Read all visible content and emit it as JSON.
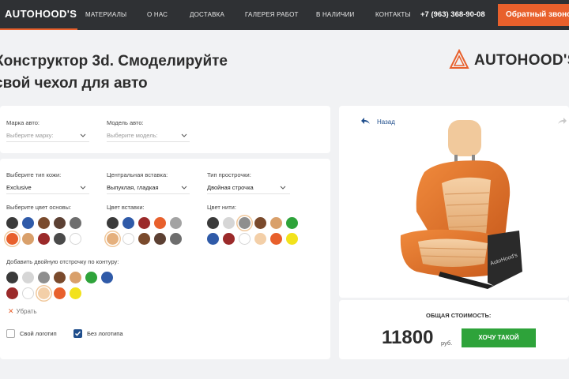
{
  "nav": {
    "logo": "AUTOHOOD'S",
    "links": [
      "МАТЕРИАЛЫ",
      "О НАС",
      "ДОСТАВКА",
      "ГАЛЕРЕЯ РАБОТ",
      "В НАЛИЧИИ",
      "КОНТАКТЫ"
    ],
    "phone": "+7 (963) 368-90-08",
    "callback": "Обратный звонок"
  },
  "header": {
    "title_line1": "Конструктор 3d. Смоделируйте",
    "title_line2": "свой чехол для авто",
    "brand": "AUTOHOOD'S"
  },
  "car": {
    "brand_label": "Марка авто:",
    "brand_placeholder": "Выберите марку:",
    "model_label": "Модель авто:",
    "model_placeholder": "Выберите модель:"
  },
  "options": {
    "leather_label": "Выберите тип кожи:",
    "leather_value": "Exclusive",
    "insert_label": "Центральная вставка:",
    "insert_value": "Выпуклая, гладкая",
    "stitch_label": "Тип прострочки:",
    "stitch_value": "Двойная строчка",
    "base_color_label": "Выберите цвет основы:",
    "insert_color_label": "Цвет вставки:",
    "thread_color_label": "Цвет нити:",
    "double_stitch_label": "Добавить двойную отстрочку по контуру:",
    "remove_label": "Убрать",
    "own_logo_label": "Свой логотип",
    "no_logo_label": "Без логотипа"
  },
  "colors": {
    "base": [
      "#3a3a3a",
      "#2f5aa8",
      "#7a4a2c",
      "#5c4033",
      "#6e6e6e",
      "#e8602c",
      "#d9a06b",
      "#9b2a2a",
      "#4a4a4a",
      "#ffffff"
    ],
    "insert": [
      "#3a3a3a",
      "#2f5aa8",
      "#9b2a2a",
      "#e8602c",
      "#a3a3a3",
      "#e5b07d",
      "#ffffff",
      "#7a4a2c",
      "#5c4033",
      "#6e6e6e"
    ],
    "thread": [
      "#3a3a3a",
      "#d6d6d6",
      "#8e8e8e",
      "#7a4a2c",
      "#d9a06b",
      "#2ea33a",
      "#2f5aa8",
      "#9b2a2a",
      "#ffffff",
      "#f3cfa8",
      "#e8602c",
      "#f2e21c"
    ],
    "double": [
      "#3a3a3a",
      "#d6d6d6",
      "#8e8e8e",
      "#7a4a2c",
      "#d9a06b",
      "#2ea33a",
      "#2f5aa8",
      "#9b2a2a",
      "#ffffff",
      "#f3cfa8",
      "#e8602c",
      "#f2e21c"
    ],
    "accent": "#e8602c",
    "buy_green": "#2ea33a"
  },
  "preview": {
    "back_label": "Назад",
    "seat_brand": "AutoHood's",
    "total_label": "ОБЩАЯ СТОИМОСТЬ:",
    "price": "11800",
    "currency": "руб.",
    "buy_label": "ХОЧУ ТАКОЙ"
  }
}
